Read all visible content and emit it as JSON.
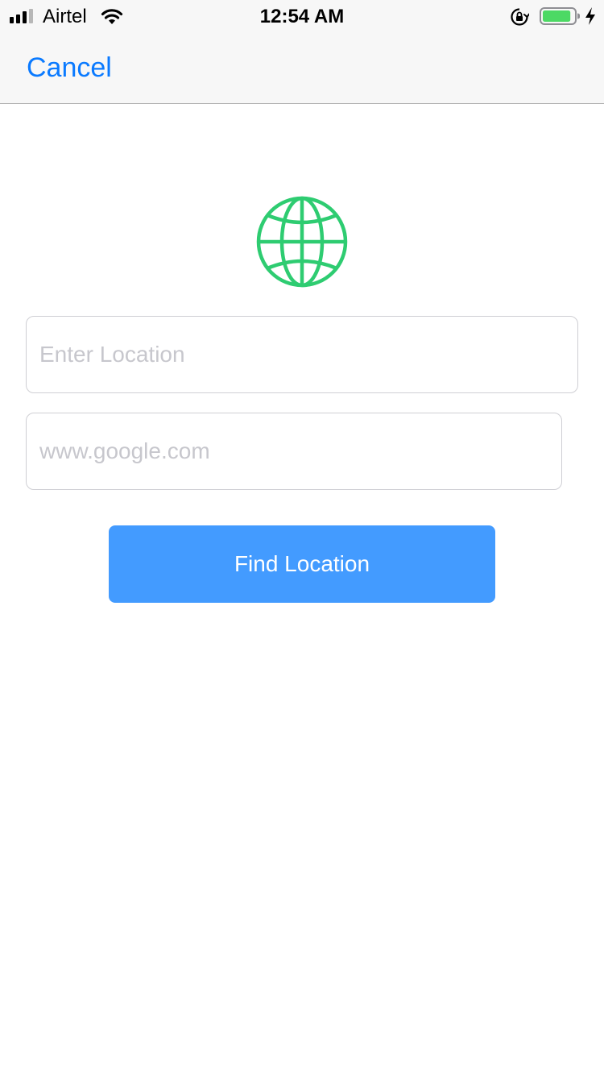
{
  "status_bar": {
    "carrier": "Airtel",
    "time": "12:54 AM",
    "signal_icon": "signal-bars-icon",
    "wifi_icon": "wifi-icon",
    "orientation_lock_icon": "orientation-lock-icon",
    "battery_icon": "battery-icon",
    "charging_icon": "charging-bolt-icon",
    "battery_level": 0.9,
    "battery_color": "#4cd964"
  },
  "nav": {
    "cancel_label": "Cancel",
    "accent_color": "#0a7aff"
  },
  "globe": {
    "icon": "globe-icon",
    "color": "#2ecc71"
  },
  "form": {
    "location_placeholder": "Enter Location",
    "location_value": "",
    "url_placeholder": "www.google.com",
    "url_value": "",
    "find_button_label": "Find Location",
    "button_color": "#439bff"
  }
}
